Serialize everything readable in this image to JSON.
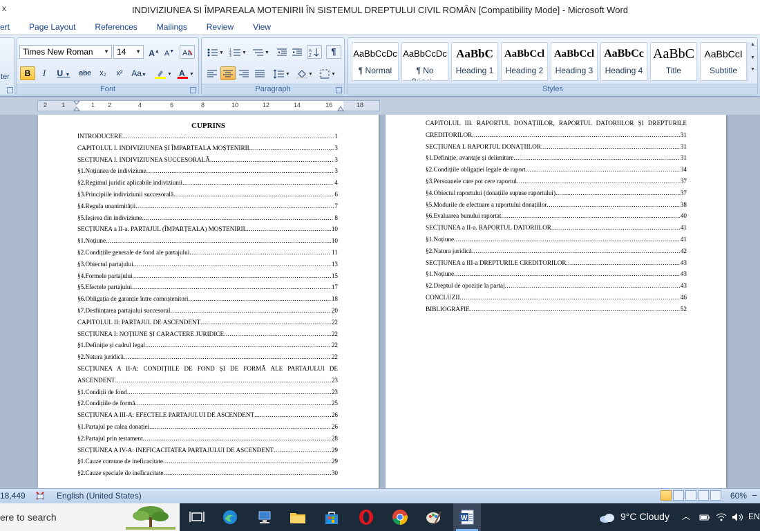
{
  "window": {
    "title": "INDIVIZIUNEA SI ÎMPAREALA MOTENIRII ÎN SISTEMUL DREPTULUI CIVIL ROMÂN [Compatibility Mode] - Microsoft Word",
    "left_fragment": "x"
  },
  "ribbon_tabs": [
    "ert",
    "Page Layout",
    "References",
    "Mailings",
    "Review",
    "View"
  ],
  "ribbon": {
    "clipboard_fragment": "ter",
    "font_name": "Times New Roman",
    "font_size": "14",
    "font_group_label": "Font",
    "paragraph_group_label": "Paragraph",
    "styles_group_label": "Styles",
    "grow_font": "A",
    "shrink_font": "A",
    "bold": "B",
    "italic": "I",
    "underline": "U",
    "strike": "abc",
    "subscript": "x₂",
    "superscript": "x²",
    "change_case": "Aa",
    "highlight_color": "#ffff00",
    "font_color": "#ff0000",
    "styles": [
      {
        "preview": "AaBbCcDc",
        "name": "¶ Normal"
      },
      {
        "preview": "AaBbCcDc",
        "name": "¶ No Spaci..."
      },
      {
        "preview": "AaBbC",
        "name": "Heading 1"
      },
      {
        "preview": "AaBbCcl",
        "name": "Heading 2"
      },
      {
        "preview": "AaBbCcl",
        "name": "Heading 3"
      },
      {
        "preview": "AaBbCc",
        "name": "Heading 4"
      },
      {
        "preview": "AaBbC",
        "name": "Title"
      },
      {
        "preview": "AaBbCcI",
        "name": "Subtitle"
      }
    ]
  },
  "ruler": {
    "numbers": [
      "2",
      "1",
      "1",
      "2",
      "4",
      "6",
      "8",
      "10",
      "12",
      "14",
      "16",
      "18"
    ]
  },
  "document": {
    "toc_title": "CUPRINS",
    "page1": [
      {
        "text": "INTRODUCERE",
        "page": "1"
      },
      {
        "text": "CAPITOLUL I. INDIVIZIUNEA ȘI ÎMPARTEALA MOȘTENIRII",
        "page": "3"
      },
      {
        "text": "SECȚIUNEA I. INDIVIZIUNEA SUCCESORALĂ",
        "page": "3"
      },
      {
        "text": "§1.Noțiunea de indiviziune",
        "page": "3"
      },
      {
        "text": "§2.Regimul juridic aplicabile indiviziunii",
        "page": "4"
      },
      {
        "text": "§3.Principiile indiviziunii succesorală",
        "page": "6"
      },
      {
        "text": "§4.Regula unanimității",
        "page": "7"
      },
      {
        "text": "§5.Ieșirea din indiviziune",
        "page": "8"
      },
      {
        "text": "SECȚIUNEA a II-a. PARTAJUL (ÎMPARȚEALA) MOȘTENIRII",
        "page": "10"
      },
      {
        "text": "§1.Noțiune",
        "page": "10"
      },
      {
        "text": "§2.Condițiile generale de fond ale partajului",
        "page": "11"
      },
      {
        "text": "§3.Obiectul partajului",
        "page": "13"
      },
      {
        "text": "§4.Formele partajului",
        "page": "15"
      },
      {
        "text": "§5.Efectele partajului",
        "page": "17"
      },
      {
        "text": "§6.Obligația de garanție între comoștenitori",
        "page": "18"
      },
      {
        "text": "§7.Desființarea partajului succesoral",
        "page": "20"
      },
      {
        "text": "CAPITOLUL II: PARTAJUL  DE ASCENDENT",
        "page": "22"
      },
      {
        "text": "SECȚIUNEA I: NOȚIUNE ȘI CARACTERE JURIDICE",
        "page": "22"
      },
      {
        "text": "§1.Definiție și cadrul legal",
        "page": "22"
      },
      {
        "text": "§2.Natura juridică",
        "page": "22"
      },
      {
        "wrap": true,
        "text": "SECȚIUNEA A II-A: CONDIȚIILE DE FOND ȘI DE FORMĂ ALE PARTAJULUI DE",
        "text2": "ASCENDENT",
        "page": "23"
      },
      {
        "text": "§1.Condiții de fond",
        "page": "23"
      },
      {
        "text": "§2.Condițiile de formă",
        "page": "25"
      },
      {
        "text": "SECȚIUNEA A III-A: EFECTELE PARTAJULUI DE ASCENDENT",
        "page": "26"
      },
      {
        "text": "§1.Partajul pe calea donației",
        "page": "26"
      },
      {
        "text": "§2.Partajul prin testament",
        "page": "28"
      },
      {
        "text": "SECȚIUNEA A IV-A: INEFICACITATEA PARTAJULUI DE ASCENDENT",
        "page": "29"
      },
      {
        "text": "§1.Cauze comune de ineficacitate",
        "page": "29"
      },
      {
        "text": "§2.Cauze speciale de ineficacitate",
        "page": "30"
      }
    ],
    "page2": [
      {
        "wrap": true,
        "text": "CAPITOLUL III.  RAPORTUL DONAȚIILOR, RAPORTUL DATORIILOR ȘI DREPTURILE",
        "text2": "CREDITORILOR",
        "page": "31"
      },
      {
        "text": "SECȚIUNEA I. RAPORTUL DONAȚIILOR",
        "page": "31"
      },
      {
        "text": "§1.Definiție, avantaje și delimitare",
        "page": "31"
      },
      {
        "text": "§2.Condițiile obligației legale de raport",
        "page": "34"
      },
      {
        "text": "§3.Persoanele care pot cere raportul",
        "page": "37"
      },
      {
        "text": "§4.Obiectul raportului (donațiile supuse raportului)",
        "page": "37"
      },
      {
        "text": "§5.Modurile de efectuare a raportului donațiilor",
        "page": "38"
      },
      {
        "text": "§6.Evaluarea bunului raportat",
        "page": "40"
      },
      {
        "text": "SECȚIUNEA a II-a. RAPORTUL DATORIILOR",
        "page": "41"
      },
      {
        "text": "§1.Noțiune",
        "page": "41"
      },
      {
        "text": "§2.Natura juridică",
        "page": "42"
      },
      {
        "text": "SECȚIUNEA a III-a DREPTURILE CREDITORILOR",
        "page": "43"
      },
      {
        "text": "§1.Noțiune",
        "page": "43"
      },
      {
        "text": "§2.Dreptul de opoziție la partaj",
        "page": "43"
      },
      {
        "text": "CONCLUZII",
        "page": "46"
      },
      {
        "text": "BIBLIOGRAFIE",
        "page": "52"
      }
    ]
  },
  "status": {
    "words": "18,449",
    "language": "English (United States)",
    "zoom": "60%",
    "zoom_minus": "−"
  },
  "taskbar": {
    "search_text": "ere to search",
    "weather": "9°C  Cloudy",
    "lang": "EN"
  }
}
